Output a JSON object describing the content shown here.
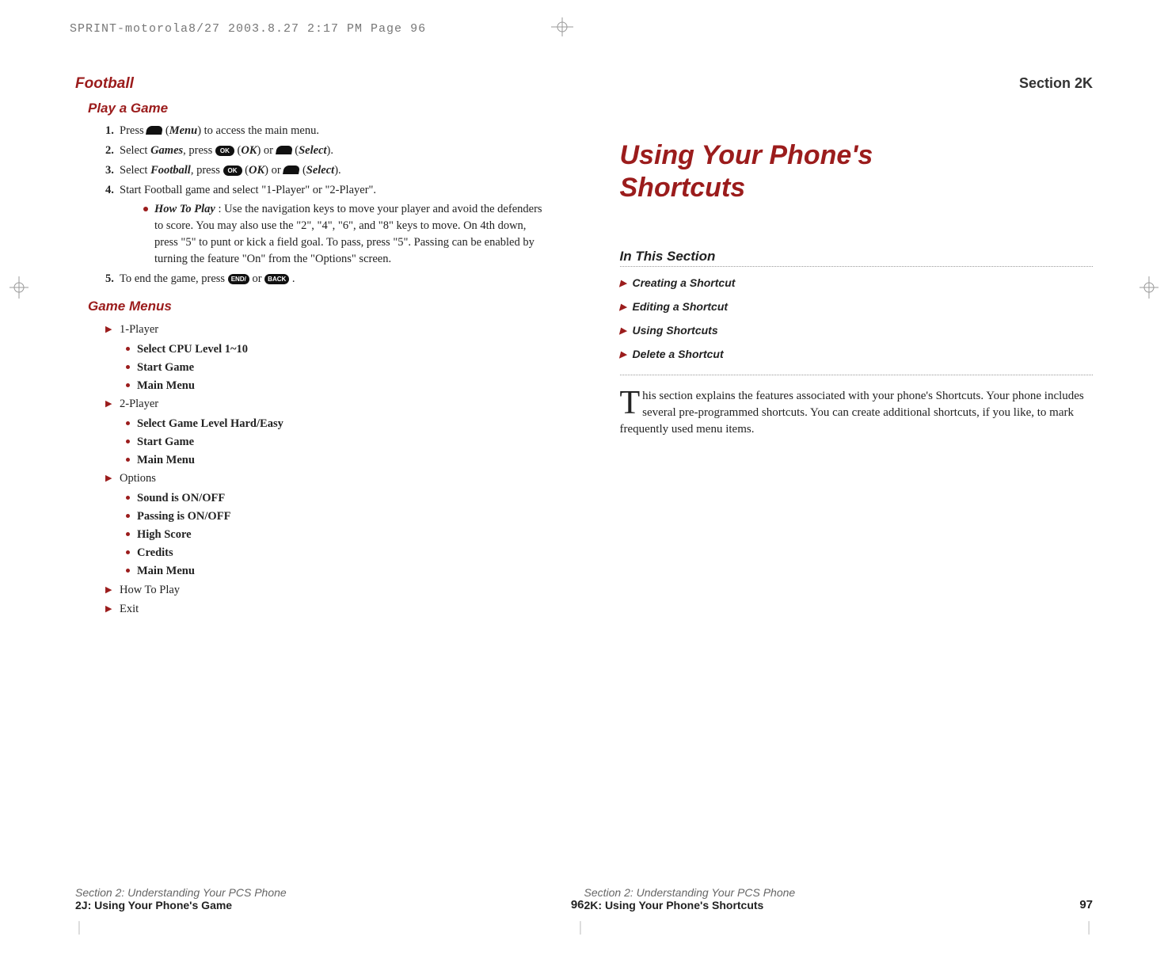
{
  "header": "SPRINT-motorola8/27  2003.8.27  2:17 PM  Page 96",
  "left": {
    "title": "Football",
    "play_heading": "Play a Game",
    "steps": [
      {
        "num": "1.",
        "pre": "Press ",
        "key_type": "soft",
        "post": " (",
        "bold1": "Menu",
        "post2": ") to access the main menu."
      },
      {
        "num": "2.",
        "pre": "Select ",
        "bold0": "Games",
        "mid": ", press ",
        "key1": "OK",
        "mid2": " (",
        "bold1": "OK",
        "mid3": ") or  ",
        "key2_type": "soft",
        "mid4": " (",
        "bold2": "Select",
        "post": ")."
      },
      {
        "num": "3.",
        "pre": "Select ",
        "bold0": "Football",
        "mid": ", press ",
        "key1": "OK",
        "mid2": " (",
        "bold1": "OK",
        "mid3": ") or  ",
        "key2_type": "soft",
        "mid4": " (",
        "bold2": "Select",
        "post": ")."
      },
      {
        "num": "4.",
        "text": "Start Football game and select \"1-Player\" or \"2-Player\"."
      },
      {
        "num": "5.",
        "pre": "To end the game, press ",
        "key1": "END/",
        "mid": " or ",
        "key2": "BACK",
        "post": " ."
      }
    ],
    "howto_label": "How To Play",
    "howto_text": " : Use the navigation keys to move your player and avoid the defenders to score. You may also use the \"2\", \"4\", \"6\", and \"8\" keys to move. On 4th down, press \"5\" to punt or kick a field goal. To pass, press \"5\". Passing can be enabled by turning the feature \"On\" from the \"Options\" screen.",
    "menus_heading": "Game Menus",
    "menus": [
      {
        "label": "1-Player",
        "items": [
          "Select CPU Level 1~10",
          "Start Game",
          "Main Menu"
        ]
      },
      {
        "label": "2-Player",
        "items": [
          "Select Game Level Hard/Easy",
          "Start Game",
          "Main Menu"
        ]
      },
      {
        "label": "Options",
        "items": [
          "Sound is ON/OFF",
          "Passing is ON/OFF",
          "High Score",
          "Credits",
          "Main Menu"
        ]
      },
      {
        "label": "How To Play",
        "items": []
      },
      {
        "label": "Exit",
        "items": []
      }
    ],
    "footer_sec": "Section 2: Understanding Your PCS Phone",
    "footer_sub": "2J: Using Your Phone's Game",
    "page_num": "96"
  },
  "right": {
    "section_label": "Section 2K",
    "big_title_1": "Using Your Phone's",
    "big_title_2": "Shortcuts",
    "in_this": "In This Section",
    "toc": [
      "Creating a Shortcut",
      "Editing a Shortcut",
      "Using Shortcuts",
      "Delete a Shortcut"
    ],
    "intro_first": "T",
    "intro_rest": "his section explains the features associated with your phone's Shortcuts. Your phone includes several pre-programmed shortcuts. You can create additional shortcuts, if you like, to mark frequently used menu items.",
    "footer_sec": "Section 2: Understanding Your PCS Phone",
    "footer_sub": "2K: Using Your Phone's Shortcuts",
    "page_num": "97"
  }
}
